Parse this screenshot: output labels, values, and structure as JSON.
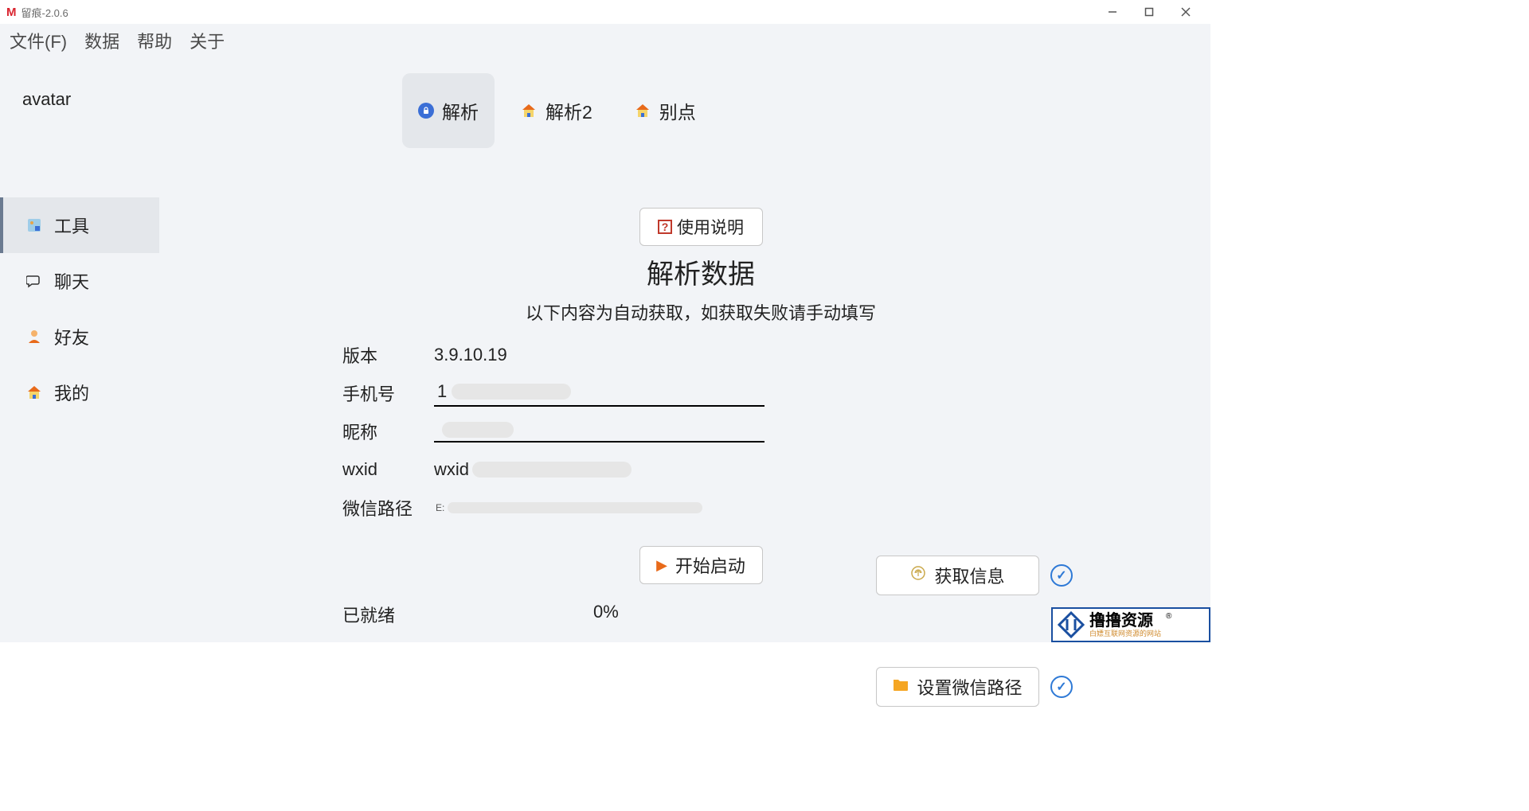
{
  "window": {
    "app_icon_letter": "M",
    "title": "留痕-2.0.6"
  },
  "menubar": {
    "file": "文件(F)",
    "data": "数据",
    "help": "帮助",
    "about": "关于"
  },
  "sidebar": {
    "avatar_label": "avatar",
    "items": [
      {
        "icon": "tools",
        "label": "工具",
        "active": true
      },
      {
        "icon": "chat",
        "label": "聊天",
        "active": false
      },
      {
        "icon": "friends",
        "label": "好友",
        "active": false
      },
      {
        "icon": "mine",
        "label": "我的",
        "active": false
      }
    ]
  },
  "tabs": [
    {
      "icon": "lock-circle",
      "label": "解析",
      "active": true
    },
    {
      "icon": "house",
      "label": "解析2",
      "active": false
    },
    {
      "icon": "house",
      "label": "别点",
      "active": false
    }
  ],
  "panel": {
    "instructions_button": "使用说明",
    "heading": "解析数据",
    "subheading": "以下内容为自动获取，如获取失败请手动填写",
    "fields": {
      "version_label": "版本",
      "version_value": "3.9.10.19",
      "phone_label": "手机号",
      "phone_value": "1",
      "nickname_label": "昵称",
      "nickname_value": "",
      "wxid_label": "wxid",
      "wxid_value": "wxid",
      "wxpath_label": "微信路径",
      "wxpath_prefix": "E:"
    },
    "buttons": {
      "fetch_info": "获取信息",
      "set_wx_path": "设置微信路径",
      "start": "开始启动"
    },
    "status_label": "已就绪",
    "progress_text": "0%"
  },
  "watermark": {
    "main": "撸撸资源",
    "sub": "白嫖互联网资源的网站",
    "reg": "®"
  }
}
